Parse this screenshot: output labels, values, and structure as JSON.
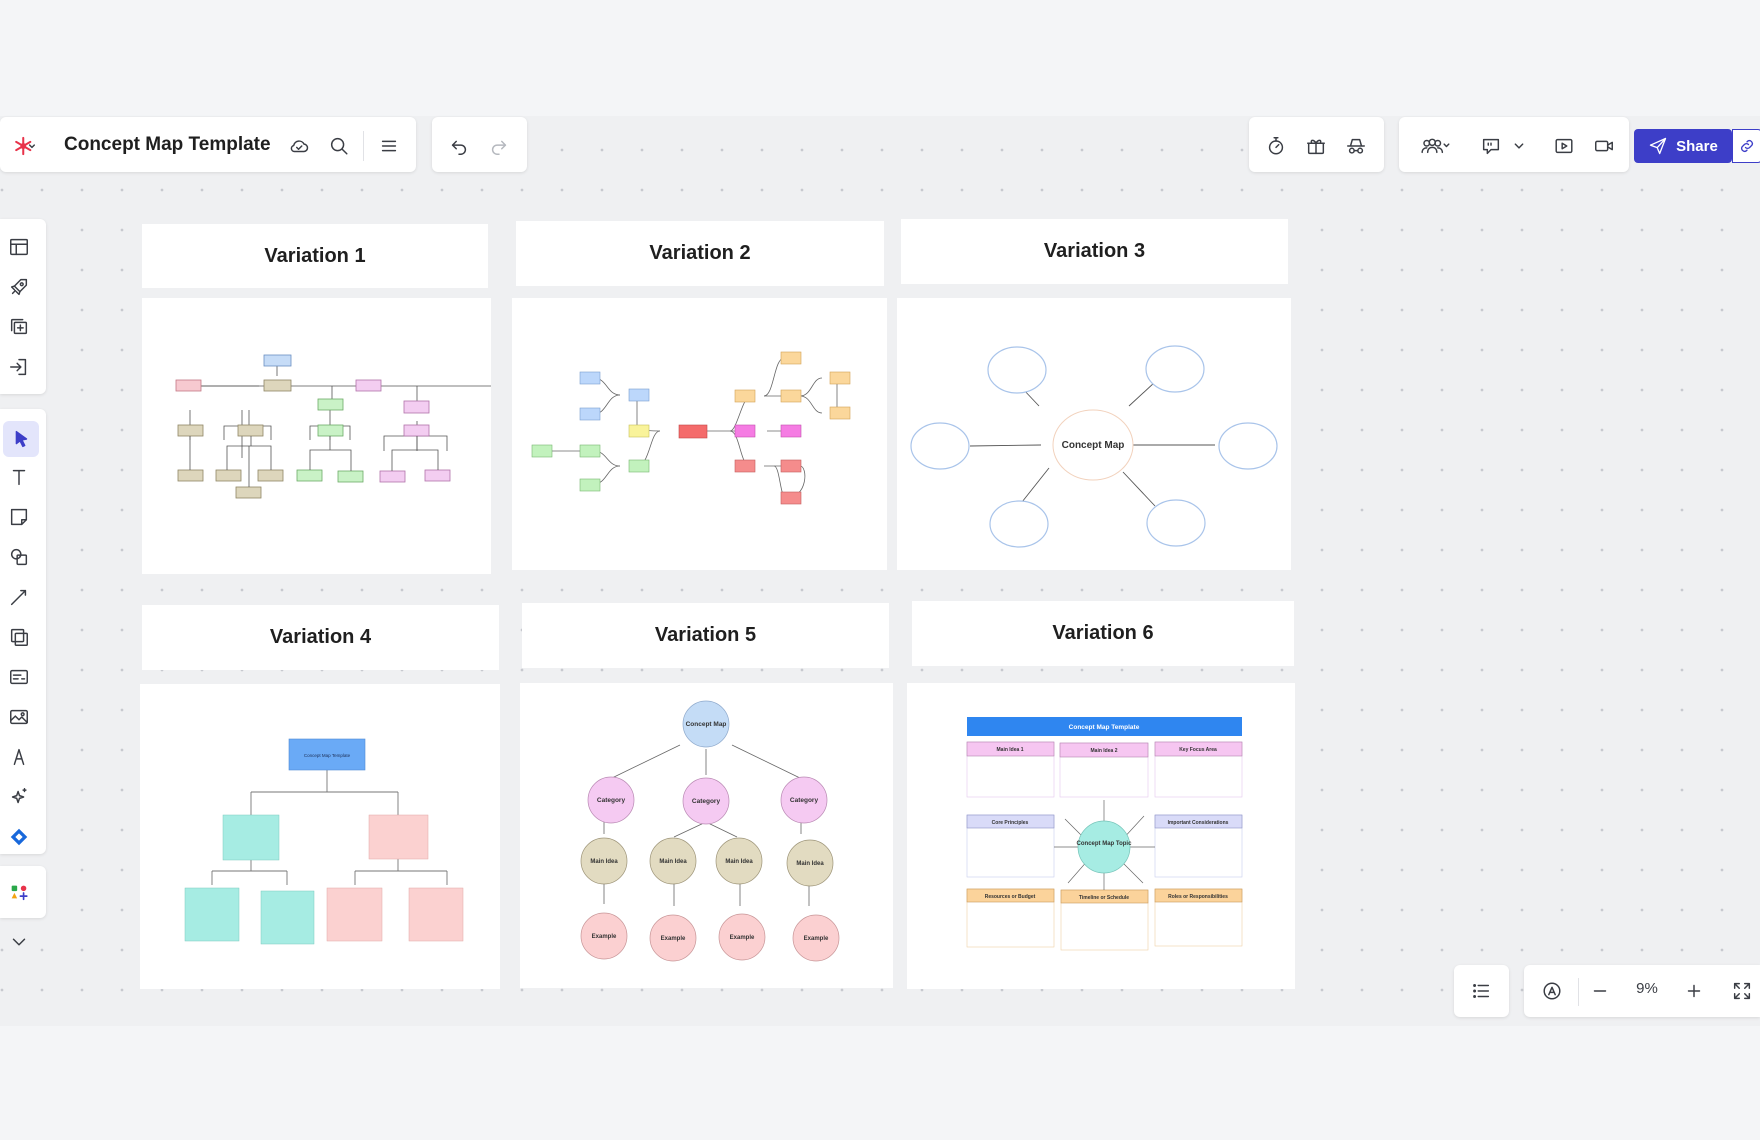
{
  "header": {
    "title": "Concept Map Template",
    "share_label": "Share",
    "brand_color": "#e8334a",
    "accent_color": "#3d3ec8"
  },
  "variations": [
    {
      "title": "Variation 1"
    },
    {
      "title": "Variation 2"
    },
    {
      "title": "Variation 3"
    },
    {
      "title": "Variation 4"
    },
    {
      "title": "Variation 5"
    },
    {
      "title": "Variation 6"
    }
  ],
  "variation3": {
    "center": "Concept Map"
  },
  "variation4": {
    "root": "Concept Map Template"
  },
  "variation5": {
    "root": "Concept Map",
    "category": "Category",
    "main_idea": "Main Idea",
    "example": "Example"
  },
  "variation6": {
    "banner": "Concept Map Template",
    "center": "Concept Map Topic",
    "boxes": [
      "Main Idea 1",
      "Main Idea 2",
      "Key Focus Area",
      "Core Principles",
      "Important Considerations",
      "Resources or Budget",
      "Timeline or Schedule",
      "Roles or Responsibilities"
    ]
  },
  "zoom": {
    "level": "9%"
  },
  "icons": {
    "toolbar": [
      "logo-icon",
      "cloud-icon",
      "search-icon",
      "menu-icon",
      "undo-icon",
      "redo-icon",
      "timer-icon",
      "gift-icon",
      "incognito-icon",
      "collaborators-icon",
      "comment-icon",
      "present-icon",
      "video-icon",
      "send-icon",
      "link-icon"
    ],
    "sidebar": [
      "layout-icon",
      "rocket-icon",
      "add-frame-icon",
      "import-icon",
      "pointer-icon",
      "text-icon",
      "sticky-note-icon",
      "shapes-icon",
      "line-icon",
      "frame-icon",
      "card-icon",
      "image-icon",
      "pen-icon",
      "ai-sparkle-icon",
      "diamond-icon",
      "apps-icon",
      "chevron-down-icon"
    ],
    "bottom": [
      "outline-icon",
      "autofit-icon",
      "zoom-out-icon",
      "zoom-in-icon",
      "fullscreen-icon"
    ]
  }
}
